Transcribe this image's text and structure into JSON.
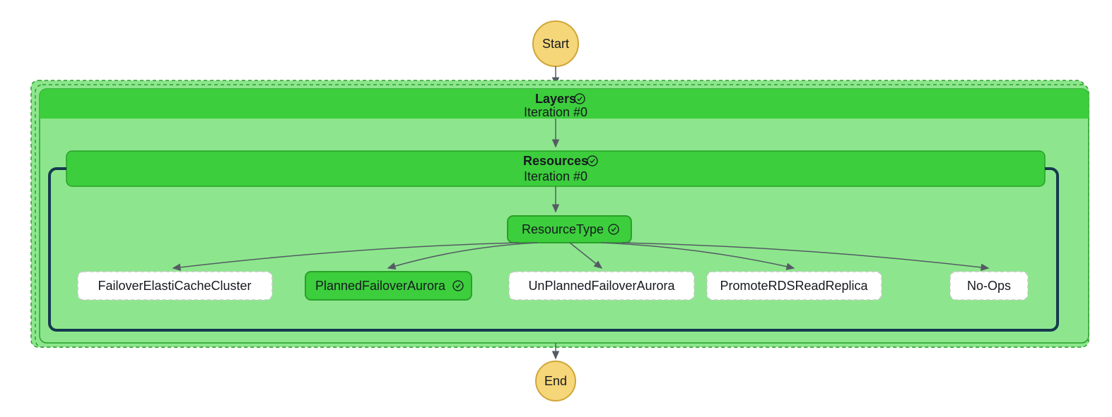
{
  "colors": {
    "yellow_fill": "#f5d678",
    "yellow_stroke": "#d1a639",
    "green_header": "#3cce3c",
    "green_light": "#8de68d",
    "green_dark_stroke": "#2aa02a",
    "white": "#ffffff",
    "dashed": "#c7c7c7",
    "dark_blue": "#16394f",
    "arrow": "#545b64"
  },
  "start": {
    "label": "Start"
  },
  "end": {
    "label": "End"
  },
  "layers": {
    "title": "Layers",
    "subtitle": "Iteration #0"
  },
  "resources": {
    "title": "Resources",
    "subtitle": "Iteration #0"
  },
  "choice": {
    "label": "ResourceType"
  },
  "branches": [
    {
      "label": "FailoverElastiCacheCluster",
      "active": false
    },
    {
      "label": "PlannedFailoverAurora",
      "active": true
    },
    {
      "label": "UnPlannedFailoverAurora",
      "active": false
    },
    {
      "label": "PromoteRDSReadReplica",
      "active": false
    },
    {
      "label": "No-Ops",
      "active": false
    }
  ]
}
